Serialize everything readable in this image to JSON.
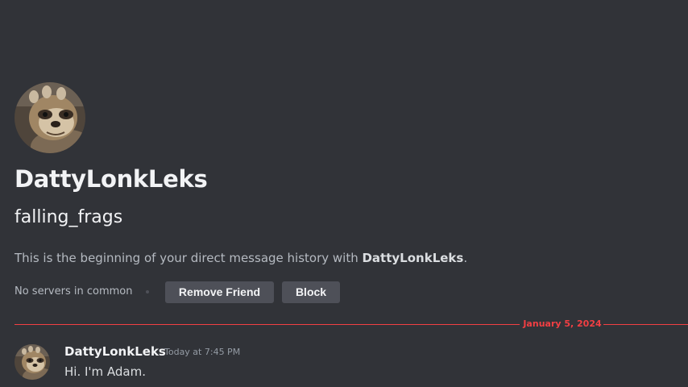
{
  "profile": {
    "display_name": "DattyLonkLeks",
    "username": "falling_frags",
    "avatar_icon": "sloth-avatar-icon",
    "description_prefix": "This is the beginning of your direct message history with ",
    "description_name": "DattyLonkLeks",
    "description_suffix": ".",
    "mutual_servers": "No servers in common"
  },
  "actions": {
    "remove_friend_label": "Remove Friend",
    "block_label": "Block"
  },
  "divider": {
    "date": "January 5, 2024",
    "color": "#f23f43"
  },
  "messages": [
    {
      "author": "DattyLonkLeks",
      "timestamp": "Today at 7:45 PM",
      "content": "Hi. I'm Adam.",
      "avatar_icon": "sloth-avatar-icon"
    }
  ],
  "colors": {
    "background": "#313338",
    "button": "#4e5058",
    "accent_red": "#f23f43"
  }
}
